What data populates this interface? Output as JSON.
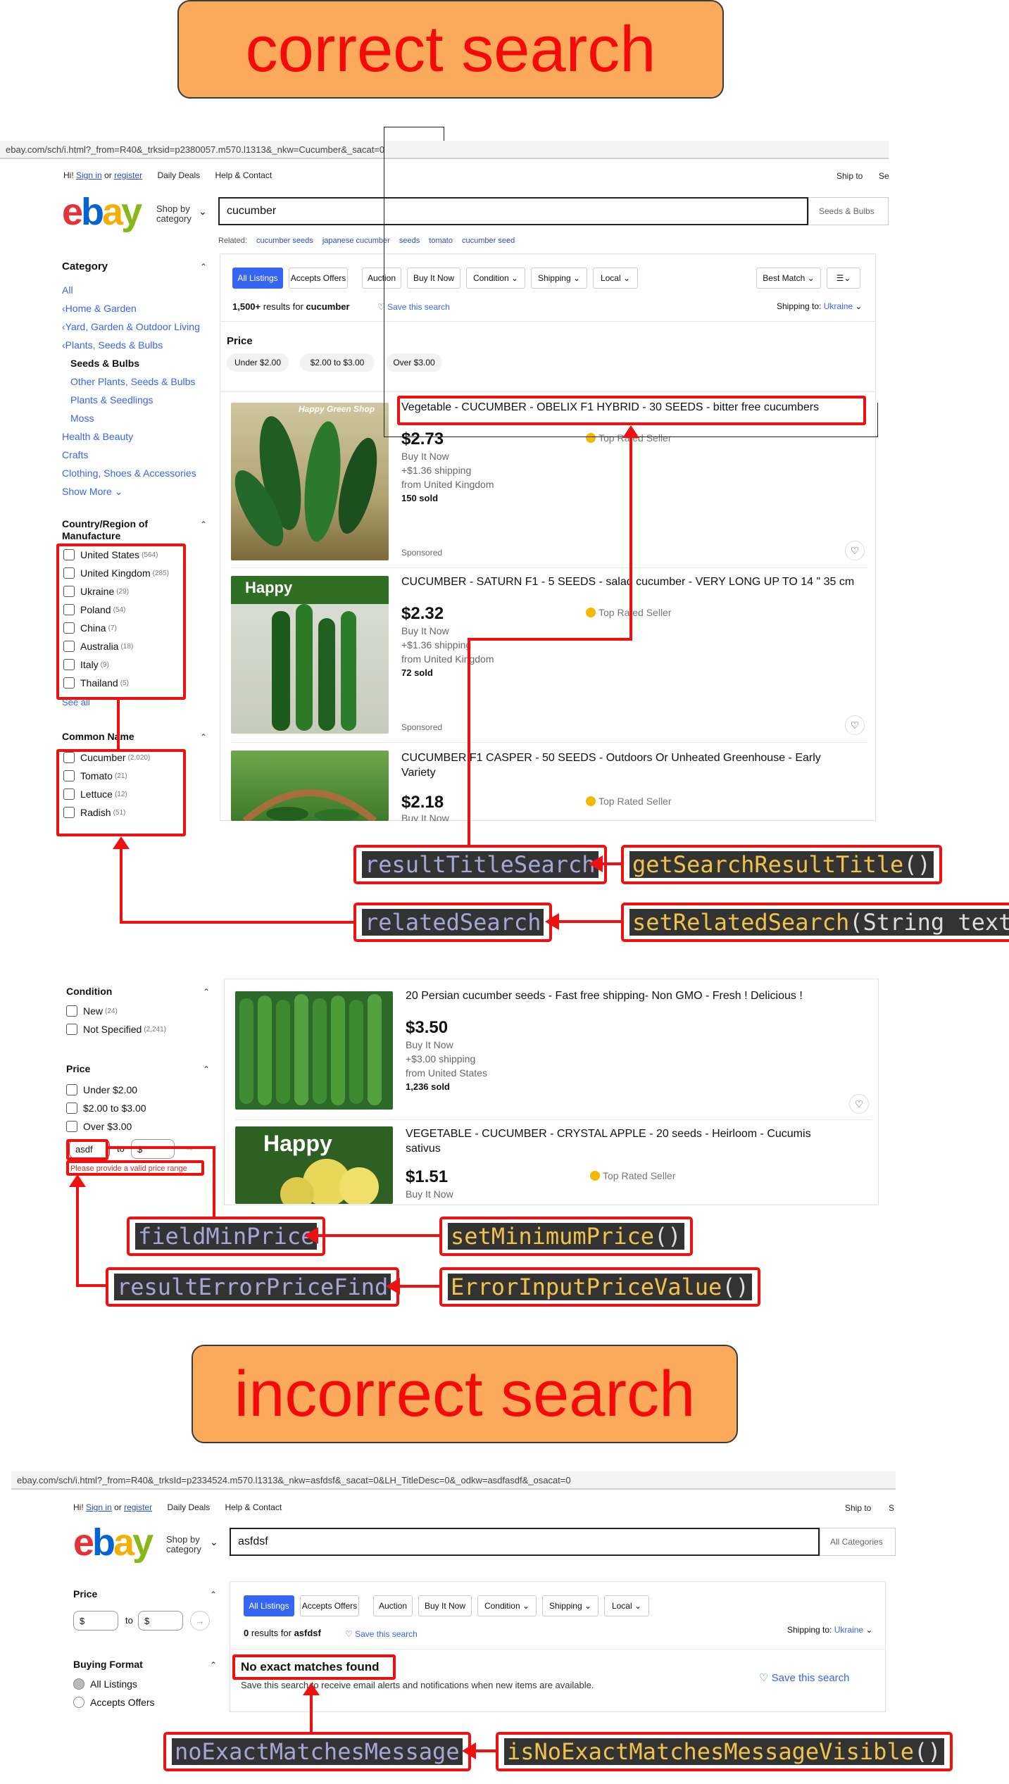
{
  "banners": {
    "correct": "correct search",
    "incorrect": "incorrect search"
  },
  "screen1": {
    "url": "ebay.com/sch/i.html?_from=R40&_trksid=p2380057.m570.l1313&_nkw=Cucumber&_sacat=0",
    "greeting": "Hi!",
    "sign_in": "Sign in",
    "or": "or",
    "register": "register",
    "daily_deals": "Daily Deals",
    "help": "Help & Contact",
    "ship_to": "Ship to",
    "ship_cut": "Se",
    "shop_by": "Shop by",
    "category": "category",
    "search_value": "cucumber",
    "search_category": "Seeds & Bulbs",
    "related_label": "Related:",
    "related": [
      "cucumber seeds",
      "japanese cucumber",
      "seeds",
      "tomato",
      "cucumber seed"
    ],
    "sidebar": {
      "category_heading": "Category",
      "all": "All",
      "crumbs": [
        "Home & Garden",
        "Yard, Garden & Outdoor Living",
        "Plants, Seeds & Bulbs"
      ],
      "current": "Seeds & Bulbs",
      "subcats": [
        "Other Plants, Seeds & Bulbs",
        "Plants & Seedlings",
        "Moss"
      ],
      "other": [
        "Health & Beauty",
        "Crafts",
        "Clothing, Shoes & Accessories"
      ],
      "show_more": "Show More",
      "country_heading": "Country/Region of Manufacture",
      "countries": [
        {
          "name": "United States",
          "count": "(564)"
        },
        {
          "name": "United Kingdom",
          "count": "(285)"
        },
        {
          "name": "Ukraine",
          "count": "(29)"
        },
        {
          "name": "Poland",
          "count": "(54)"
        },
        {
          "name": "China",
          "count": "(7)"
        },
        {
          "name": "Australia",
          "count": "(18)"
        },
        {
          "name": "Italy",
          "count": "(9)"
        },
        {
          "name": "Thailand",
          "count": "(5)"
        }
      ],
      "see_all": "See all",
      "common_heading": "Common Name",
      "common": [
        {
          "name": "Cucumber",
          "count": "(2,020)"
        },
        {
          "name": "Tomato",
          "count": "(21)"
        },
        {
          "name": "Lettuce",
          "count": "(12)"
        },
        {
          "name": "Radish",
          "count": "(51)"
        }
      ]
    },
    "filters": [
      "All Listings",
      "Accepts Offers",
      "Auction",
      "Buy It Now",
      "Condition",
      "Shipping",
      "Local"
    ],
    "sort": "Best Match",
    "results_count": "1,500+",
    "results_for": "results for",
    "results_query": "cucumber",
    "save_search": "Save this search",
    "shipping_to": "Shipping to:",
    "shipping_country": "Ukraine",
    "price_heading": "Price",
    "price_chips": [
      "Under $2.00",
      "$2.00 to $3.00",
      "Over $3.00"
    ],
    "items": [
      {
        "title": "Vegetable - CUCUMBER - OBELIX F1 HYBRID - 30 SEEDS - bitter free cucumbers",
        "price": "$2.73",
        "format": "Buy It Now",
        "shipping": "+$1.36 shipping",
        "from": "from United Kingdom",
        "sold": "150 sold",
        "seller": "Top Rated Seller",
        "sponsored": "Sponsored",
        "img_text": "Happy Green Shop"
      },
      {
        "title": "CUCUMBER - SATURN F1 - 5 SEEDS - salad cucumber - VERY LONG UP TO 14 \" 35 cm",
        "price": "$2.32",
        "format": "Buy It Now",
        "shipping": "+$1.36 shipping",
        "from": "from United Kingdom",
        "sold": "72 sold",
        "seller": "Top Rated Seller",
        "sponsored": "Sponsored",
        "img_text": "Happy"
      },
      {
        "title": "CUCUMBER F1 CASPER - 50 SEEDS - Outdoors Or Unheated Greenhouse - Early Variety",
        "price": "$2.18",
        "format": "Buy It Now",
        "seller": "Top Rated Seller"
      }
    ]
  },
  "screen2": {
    "condition_heading": "Condition",
    "conditions": [
      {
        "name": "New",
        "count": "(24)"
      },
      {
        "name": "Not Specified",
        "count": "(2,241)"
      }
    ],
    "price_heading": "Price",
    "price_options": [
      "Under $2.00",
      "$2.00 to $3.00",
      "Over $3.00"
    ],
    "min_value": "asdf",
    "to": "to",
    "max_placeholder": "$",
    "error": "Please provide a valid price range",
    "items": [
      {
        "title": "20 Persian cucumber seeds - Fast free shipping- Non GMO - Fresh ! Delicious !",
        "price": "$3.50",
        "format": "Buy It Now",
        "shipping": "+$3.00 shipping",
        "from": "from United States",
        "sold": "1,236 sold"
      },
      {
        "title": "VEGETABLE - CUCUMBER - CRYSTAL APPLE - 20 seeds - Heirloom - Cucumis sativus",
        "price": "$1.51",
        "format": "Buy It Now",
        "seller": "Top Rated Seller",
        "img_text": "Happy"
      }
    ]
  },
  "screen3": {
    "url": "ebay.com/sch/i.html?_from=R40&_trksId=p2334524.m570.l1313&_nkw=asfdsf&_sacat=0&LH_TitleDesc=0&_odkw=asdfasdf&_osacat=0",
    "greeting": "Hi!",
    "sign_in": "Sign in",
    "or": "or",
    "register": "register",
    "daily_deals": "Daily Deals",
    "help": "Help & Contact",
    "ship_to": "Ship to",
    "ship_cut": "S",
    "shop_by": "Shop by",
    "category": "category",
    "search_value": "asfdsf",
    "search_category": "All Categories",
    "price_heading": "Price",
    "min_placeholder": "$",
    "to": "to",
    "max_placeholder": "$",
    "buying_heading": "Buying Format",
    "buying": [
      "All Listings",
      "Accepts Offers"
    ],
    "filters": [
      "All Listings",
      "Accepts Offers",
      "Auction",
      "Buy It Now",
      "Condition",
      "Shipping",
      "Local"
    ],
    "results_count": "0",
    "results_for": "results for",
    "results_query": "asfdsf",
    "save_search": "Save this search",
    "shipping_to": "Shipping to:",
    "shipping_country": "Ukraine",
    "no_match": "No exact matches found",
    "no_match_sub": "Save this search to receive email alerts and notifications when new items are available.",
    "save_search_2": "Save this search"
  },
  "annotations": {
    "resultTitleSearch": "resultTitleSearch",
    "getSearchResultTitle": "getSearchResultTitle",
    "relatedSearch": "relatedSearch",
    "setRelatedSearch": "setRelatedSearch",
    "setRelatedSearch_arg": "String text",
    "fieldMinPrice": "fieldMinPrice",
    "setMinimumPrice": "setMinimumPrice",
    "resultErrorPriceFind": "resultErrorPriceFind",
    "ErrorInputPriceValue": "ErrorInputPriceValue",
    "noExactMatchesMessage": "noExactMatchesMessage",
    "isNoExactMatchesMessageVisible": "isNoExactMatchesMessageVisible",
    "parens": "()"
  },
  "colors": {
    "banner_bg": "#fba95b",
    "banner_text": "#f40a0a",
    "annotation_red": "#ee1111",
    "ebay_blue": "#3665f3"
  }
}
